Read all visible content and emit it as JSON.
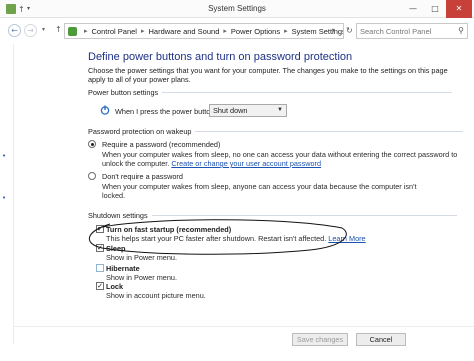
{
  "window": {
    "title": "System Settings",
    "minimize_glyph": "—",
    "maximize_glyph": "□",
    "close_glyph": "✕"
  },
  "nav": {
    "back_glyph": "←",
    "forward_glyph": "→",
    "up_glyph": "↑",
    "breadcrumbs": [
      "Control Panel",
      "Hardware and Sound",
      "Power Options",
      "System Settings"
    ],
    "crumb_separator": "▸",
    "search_placeholder": "Search Control Panel",
    "icons": [
      "back-icon",
      "forward-icon",
      "up-icon",
      "refresh-icon",
      "search-icon"
    ]
  },
  "main": {
    "heading": "Define power buttons and turn on password protection",
    "intro": "Choose the power settings that you want for your computer. The changes you make to the settings on this page apply to all of your power plans."
  },
  "power_buttons": {
    "group_title": "Power button settings",
    "label": "When I press the power button:",
    "selected": "Shut down"
  },
  "password": {
    "group_title": "Password protection on wakeup",
    "require": {
      "label": "Require a password (recommended)",
      "desc_prefix": "When your computer wakes from sleep, no one can access your data without entering the correct password to unlock the computer. ",
      "link": "Create or change your user account password",
      "checked": true
    },
    "dont_require": {
      "label": "Don't require a password",
      "desc": "When your computer wakes from sleep, anyone can access your data because the computer isn't locked.",
      "checked": false
    }
  },
  "shutdown": {
    "group_title": "Shutdown settings",
    "fast_startup": {
      "label": "Turn on fast startup (recommended)",
      "desc": "This helps start your PC faster after shutdown. Restart isn't affected. ",
      "link": "Learn More",
      "checked": true
    },
    "sleep": {
      "label": "Sleep",
      "desc": "Show in Power menu.",
      "checked": true
    },
    "hibernate": {
      "label": "Hibernate",
      "desc": "Show in Power menu.",
      "checked": false
    },
    "lock": {
      "label": "Lock",
      "desc": "Show in account picture menu.",
      "checked": true
    }
  },
  "footer": {
    "save_label": "Save changes",
    "cancel_label": "Cancel"
  },
  "colors": {
    "heading": "#1e3287",
    "link": "#1a53b0",
    "close_button": "#c7403a",
    "annotation": "#111111"
  }
}
